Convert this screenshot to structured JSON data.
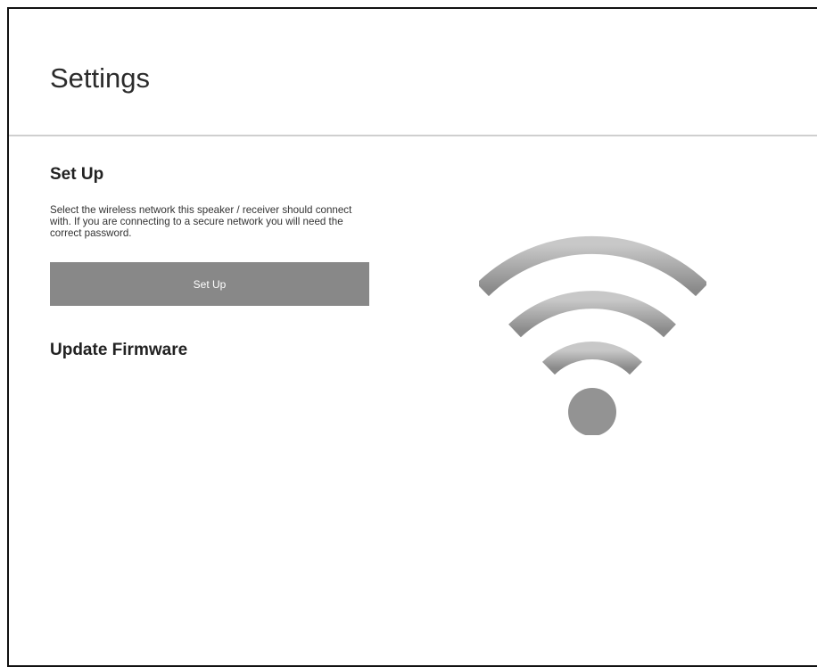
{
  "header": {
    "title": "Settings"
  },
  "setup": {
    "title": "Set Up",
    "description": "Select the wireless network this speaker / receiver should connect with. If you are connecting to a secure network you will need the correct password.",
    "button_label": "Set Up"
  },
  "firmware": {
    "title": "Update Firmware"
  },
  "illustration": {
    "icon": "wifi-icon",
    "color_light": "#c8c8c8",
    "color_dark": "#8a8a8a"
  }
}
